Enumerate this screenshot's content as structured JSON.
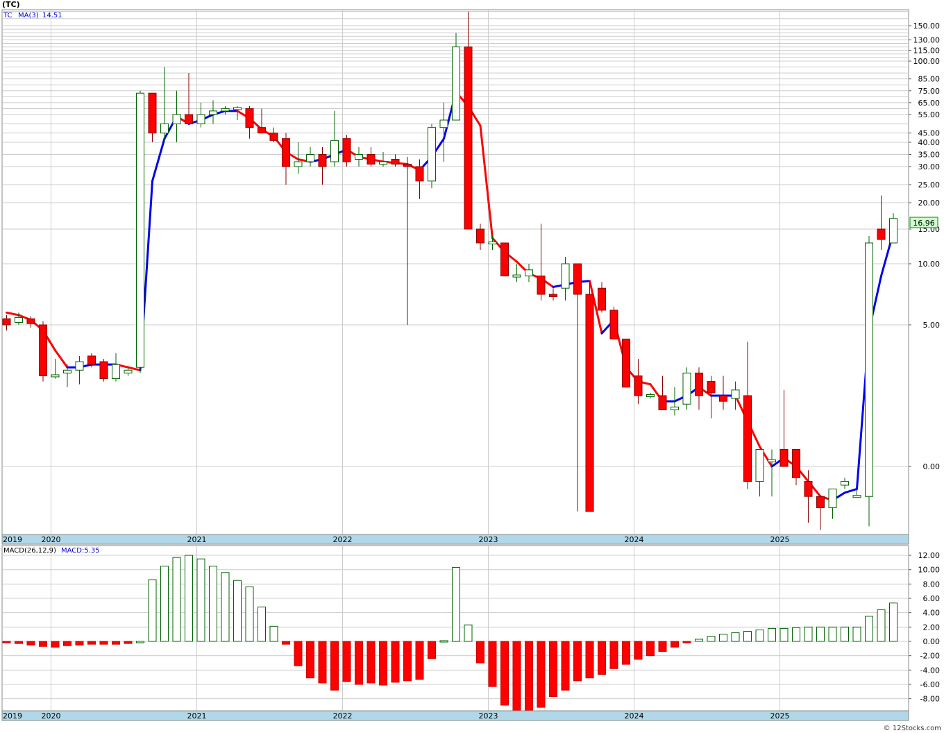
{
  "title": "(TC)",
  "legend": {
    "symbol": "TC",
    "ma_label": "MA(3)",
    "ma_value": "14.51"
  },
  "macd_legend": {
    "label": "MACD(26,12,9)",
    "value_label": "MACD:5.35"
  },
  "last_price_label": "16.96",
  "watermark": "© 12Stocks.com",
  "colors": {
    "up": "#006400",
    "down": "#ff0000",
    "ma_up": "#0000ee",
    "ma_down": "#ff0000",
    "axis_bar": "#b0d8e8"
  },
  "price_ticks": [
    {
      "value": 150,
      "label": "150.00"
    },
    {
      "value": 130,
      "label": "130.00"
    },
    {
      "value": 115,
      "label": "115.00"
    },
    {
      "value": 100,
      "label": "100.00"
    },
    {
      "value": 85,
      "label": "85.00"
    },
    {
      "value": 75,
      "label": "75.00"
    },
    {
      "value": 65,
      "label": "65.00"
    },
    {
      "value": 55,
      "label": "55.00"
    },
    {
      "value": 45,
      "label": "45.00"
    },
    {
      "value": 40,
      "label": "40.00"
    },
    {
      "value": 35,
      "label": "35.00"
    },
    {
      "value": 30,
      "label": "30.00"
    },
    {
      "value": 25,
      "label": "25.00"
    },
    {
      "value": 20,
      "label": "20.00"
    },
    {
      "value": 15,
      "label": "15.00"
    },
    {
      "value": 10,
      "label": "10.00"
    },
    {
      "value": 5,
      "label": "5.00"
    },
    {
      "value": 0,
      "label": "0.00"
    }
  ],
  "macd_ticks": [
    {
      "value": 12,
      "label": "12.00"
    },
    {
      "value": 10,
      "label": "10.00"
    },
    {
      "value": 8,
      "label": "8.00"
    },
    {
      "value": 6,
      "label": "6.00"
    },
    {
      "value": 4,
      "label": "4.00"
    },
    {
      "value": 2,
      "label": "2.00"
    },
    {
      "value": 0,
      "label": "0.00"
    },
    {
      "value": -2,
      "label": "-2.00"
    },
    {
      "value": -4,
      "label": "-4.00"
    },
    {
      "value": -6,
      "label": "-6.00"
    },
    {
      "value": -8,
      "label": "-8.00"
    }
  ],
  "year_labels": [
    {
      "label": "2019",
      "index": 0
    },
    {
      "label": "2020",
      "index": 4
    },
    {
      "label": "2021",
      "index": 16
    },
    {
      "label": "2022",
      "index": 28
    },
    {
      "label": "2023",
      "index": 40
    },
    {
      "label": "2024",
      "index": 52
    },
    {
      "label": "2025",
      "index": 64
    }
  ],
  "chart_data": {
    "type": "candlestick",
    "period": "monthly",
    "start": "2019-09",
    "candles": [
      [
        5.5,
        5.8,
        4.8,
        5.0
      ],
      [
        5.2,
        6.0,
        5.0,
        5.6
      ],
      [
        5.5,
        5.7,
        4.9,
        5.1
      ],
      [
        5.0,
        5.3,
        3.0,
        3.2
      ],
      [
        3.2,
        3.8,
        3.1,
        3.2
      ],
      [
        3.3,
        3.6,
        2.8,
        3.4
      ],
      [
        3.4,
        3.9,
        2.9,
        3.7
      ],
      [
        3.9,
        4.0,
        3.5,
        3.6
      ],
      [
        3.7,
        3.8,
        3.0,
        3.1
      ],
      [
        3.1,
        4.0,
        3.0,
        3.6
      ],
      [
        3.3,
        3.5,
        3.2,
        3.4
      ],
      [
        3.5,
        75,
        3.3,
        73
      ],
      [
        73,
        73,
        40,
        45
      ],
      [
        45,
        95,
        40,
        50
      ],
      [
        50,
        75,
        40,
        55
      ],
      [
        55,
        90,
        50,
        50
      ],
      [
        50,
        65,
        48,
        55
      ],
      [
        55,
        67,
        50,
        58
      ],
      [
        58,
        62,
        55,
        60
      ],
      [
        60,
        62,
        52,
        60
      ],
      [
        60,
        62,
        42,
        48
      ],
      [
        48,
        60,
        45,
        45
      ],
      [
        45,
        48,
        40,
        41
      ],
      [
        42,
        45,
        25,
        30
      ],
      [
        30,
        40,
        28,
        32
      ],
      [
        32,
        38,
        30,
        35
      ],
      [
        35,
        38,
        25,
        30
      ],
      [
        32,
        58,
        30,
        41
      ],
      [
        42,
        44,
        30,
        32
      ],
      [
        33,
        38,
        30,
        35
      ],
      [
        35,
        38,
        30,
        31
      ],
      [
        31,
        36,
        30,
        32
      ],
      [
        33,
        35,
        30,
        31
      ],
      [
        31,
        34,
        5.0,
        30
      ],
      [
        30,
        33,
        21,
        26
      ],
      [
        26,
        50,
        24,
        48
      ],
      [
        48,
        65,
        32,
        52
      ],
      [
        52,
        140,
        52,
        120
      ],
      [
        120,
        170,
        15,
        15
      ],
      [
        15,
        16,
        12,
        13
      ],
      [
        13,
        14,
        12,
        13
      ],
      [
        13,
        13,
        9.0,
        9.0
      ],
      [
        9.0,
        10,
        8.5,
        9.0
      ],
      [
        9.0,
        10,
        8.5,
        9.5
      ],
      [
        9.0,
        16,
        7.0,
        7.5
      ],
      [
        7.5,
        8.0,
        7.0,
        7.3
      ],
      [
        8.0,
        11,
        7.0,
        10
      ],
      [
        10,
        10,
        -1.2,
        7.5
      ],
      [
        7.5,
        8.5,
        -1.2,
        -1.2
      ],
      [
        8.0,
        8.5,
        6.0,
        6.2
      ],
      [
        6.2,
        6.5,
        4.5,
        4.5
      ],
      [
        4.5,
        4.5,
        2.8,
        2.8
      ],
      [
        3.2,
        3.8,
        2.2,
        2.5
      ],
      [
        2.5,
        2.6,
        2.4,
        2.5
      ],
      [
        2.5,
        3.2,
        2.0,
        2.0
      ],
      [
        2.0,
        2.8,
        1.8,
        2.1
      ],
      [
        2.2,
        3.5,
        2.0,
        3.3
      ],
      [
        3.3,
        3.5,
        2.0,
        2.5
      ],
      [
        3.0,
        3.2,
        1.7,
        2.6
      ],
      [
        2.5,
        3.2,
        2.0,
        2.3
      ],
      [
        2.4,
        3.0,
        2.0,
        2.7
      ],
      [
        2.5,
        4.4,
        -0.6,
        -0.4
      ],
      [
        -0.4,
        0.1,
        -0.8,
        0.6
      ],
      [
        0.2,
        0.6,
        -0.8,
        0.2
      ],
      [
        0.6,
        2.7,
        0.3,
        0.0
      ],
      [
        0.6,
        0.6,
        -0.5,
        -0.3
      ],
      [
        -0.4,
        -0.1,
        -1.5,
        -0.8
      ],
      [
        -0.8,
        -0.9,
        -1.7,
        -1.1
      ],
      [
        -1.1,
        -0.6,
        -1.4,
        -0.6
      ],
      [
        -0.5,
        -0.3,
        -0.6,
        -0.4
      ],
      [
        -0.8,
        -0.6,
        -0.8,
        -0.8
      ],
      [
        -0.8,
        14,
        -1.6,
        13
      ],
      [
        15,
        22,
        12,
        13.5
      ],
      [
        13,
        18,
        13,
        17
      ]
    ],
    "ma3": [
      6.0,
      5.8,
      5.4,
      4.8,
      4.1,
      3.5,
      3.5,
      3.6,
      3.6,
      3.6,
      3.5,
      3.4,
      26,
      42,
      54,
      50,
      52,
      55,
      58,
      58,
      53,
      47,
      43,
      36,
      33,
      32,
      33,
      35,
      37,
      34,
      33,
      32,
      31.5,
      31,
      29,
      34,
      42,
      74,
      62,
      49,
      13.7,
      11.7,
      10.3,
      9.2,
      8.8,
      8.1,
      8.3,
      8.5,
      8.6,
      4.7,
      5.4,
      3.5,
      3.0,
      2.9,
      2.3,
      2.3,
      2.5,
      2.8,
      2.5,
      2.5,
      2.5,
      1.6,
      0.7,
      0.0,
      0.3,
      0.0,
      -0.4,
      -0.8,
      -0.9,
      -0.7,
      -0.6,
      4.8,
      9.0,
      14.5
    ],
    "macd": [
      -0.2,
      -0.3,
      -0.5,
      -0.7,
      -0.8,
      -0.6,
      -0.5,
      -0.4,
      -0.4,
      -0.4,
      -0.3,
      0,
      8.6,
      10.5,
      11.7,
      12.0,
      11.5,
      10.5,
      9.6,
      8.5,
      7.6,
      4.8,
      2.1,
      -0.4,
      -3.4,
      -5.1,
      -5.8,
      -6.8,
      -5.6,
      -6.0,
      -5.8,
      -6.1,
      -5.7,
      -5.5,
      -5.3,
      -2.4,
      0.1,
      10.3,
      2.3,
      -3.0,
      -6.3,
      -8.9,
      -10.0,
      -10.0,
      -9.2,
      -7.7,
      -6.8,
      -5.5,
      -5.1,
      -4.6,
      -3.8,
      -3.2,
      -2.5,
      -2.0,
      -1.4,
      -0.8,
      -0.2,
      0.3,
      0.7,
      1.0,
      1.2,
      1.4,
      1.6,
      1.8,
      1.8,
      1.9,
      2.0,
      2.0,
      2.0,
      2.0,
      2.0,
      3.5,
      4.4,
      5.35
    ]
  }
}
